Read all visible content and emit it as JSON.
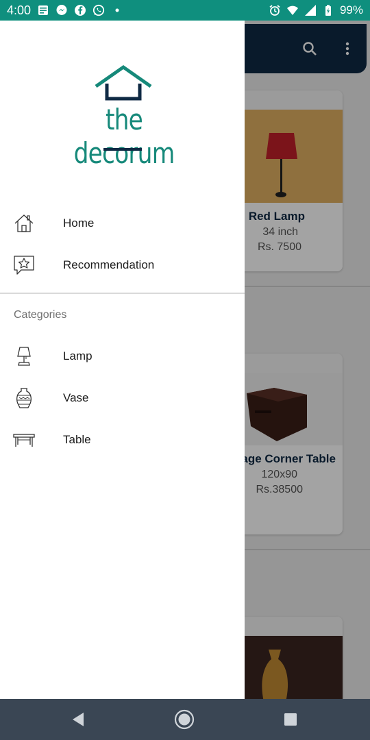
{
  "status_bar": {
    "time": "4:00",
    "battery": "99%",
    "left_icons": [
      "news-icon",
      "messenger-icon",
      "facebook-icon",
      "whatsapp-icon",
      "dot-icon"
    ],
    "right_icons": [
      "alarm-icon",
      "wifi-icon",
      "signal-icon",
      "battery-icon"
    ]
  },
  "drawer": {
    "logo_text": "the decorum",
    "items": [
      {
        "label": "Home",
        "icon": "home-icon"
      },
      {
        "label": "Recommendation",
        "icon": "star-chat-icon"
      }
    ],
    "categories_title": "Categories",
    "categories": [
      {
        "label": "Lamp",
        "icon": "lamp-icon"
      },
      {
        "label": "Vase",
        "icon": "vase-icon"
      },
      {
        "label": "Table",
        "icon": "table-icon"
      }
    ]
  },
  "background": {
    "products": [
      {
        "title": "Red Lamp",
        "size": "34 inch",
        "price": "Rs. 7500"
      },
      {
        "title": "age Corner Table",
        "size": "120x90",
        "price": "Rs.38500"
      }
    ]
  },
  "colors": {
    "status_bar": "#0f8f7e",
    "brand_teal": "#16897a",
    "brand_navy": "#0f2a44",
    "nav_bar": "#3a4654"
  }
}
